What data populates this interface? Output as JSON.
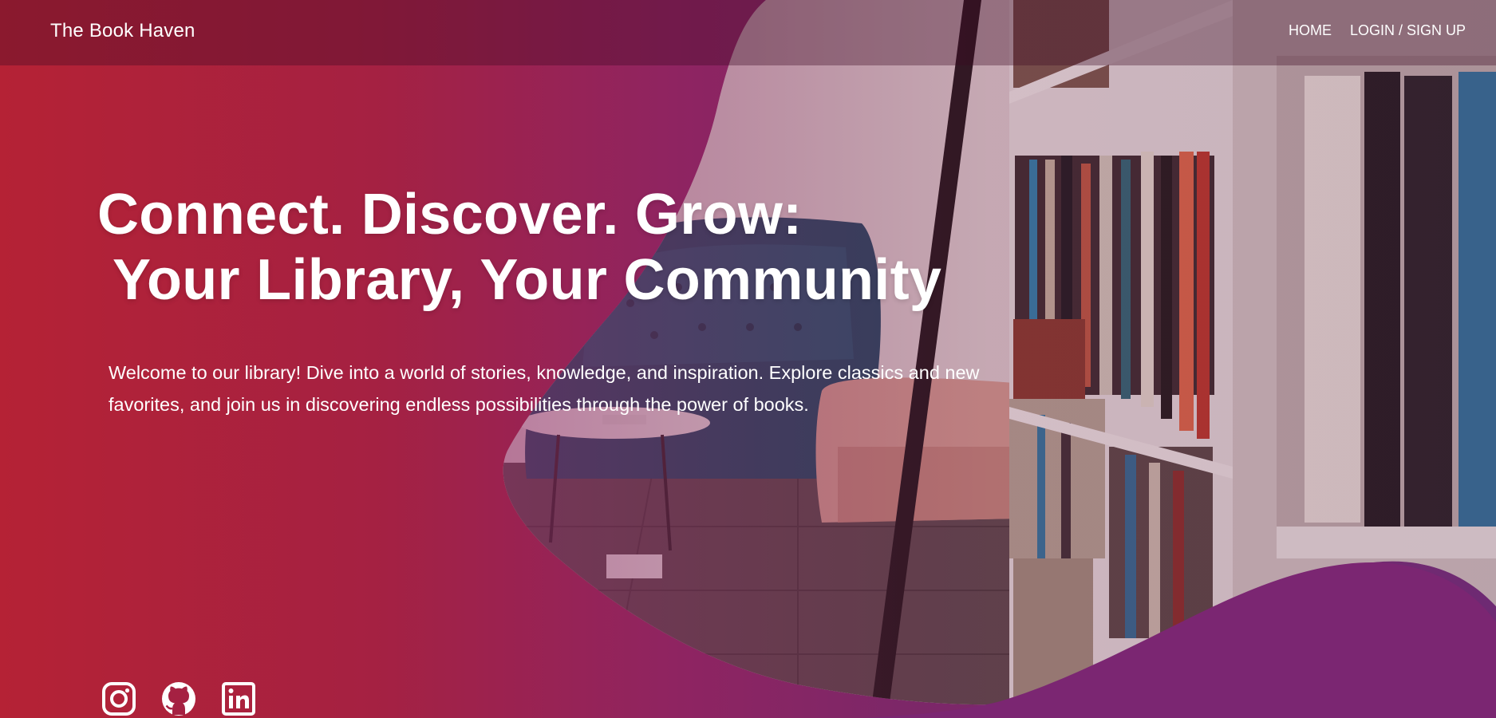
{
  "header": {
    "brand": "The Book Haven",
    "nav": [
      {
        "label": "HOME"
      },
      {
        "label": "LOGIN / SIGN UP"
      }
    ]
  },
  "hero": {
    "headline_line1": "Connect. Discover. Grow:",
    "headline_line2": " Your Library, Your Community",
    "intro": "Welcome to our library! Dive into a world of stories, knowledge, and inspiration. Explore classics and new favorites, and join us in discovering endless possibilities through the power of books."
  },
  "socials": [
    {
      "icon": "instagram-icon"
    },
    {
      "icon": "github-icon"
    },
    {
      "icon": "linkedin-icon"
    }
  ],
  "colors": {
    "gradient_left": "#b52235",
    "gradient_right": "#6e2a73",
    "text": "#ffffff"
  }
}
